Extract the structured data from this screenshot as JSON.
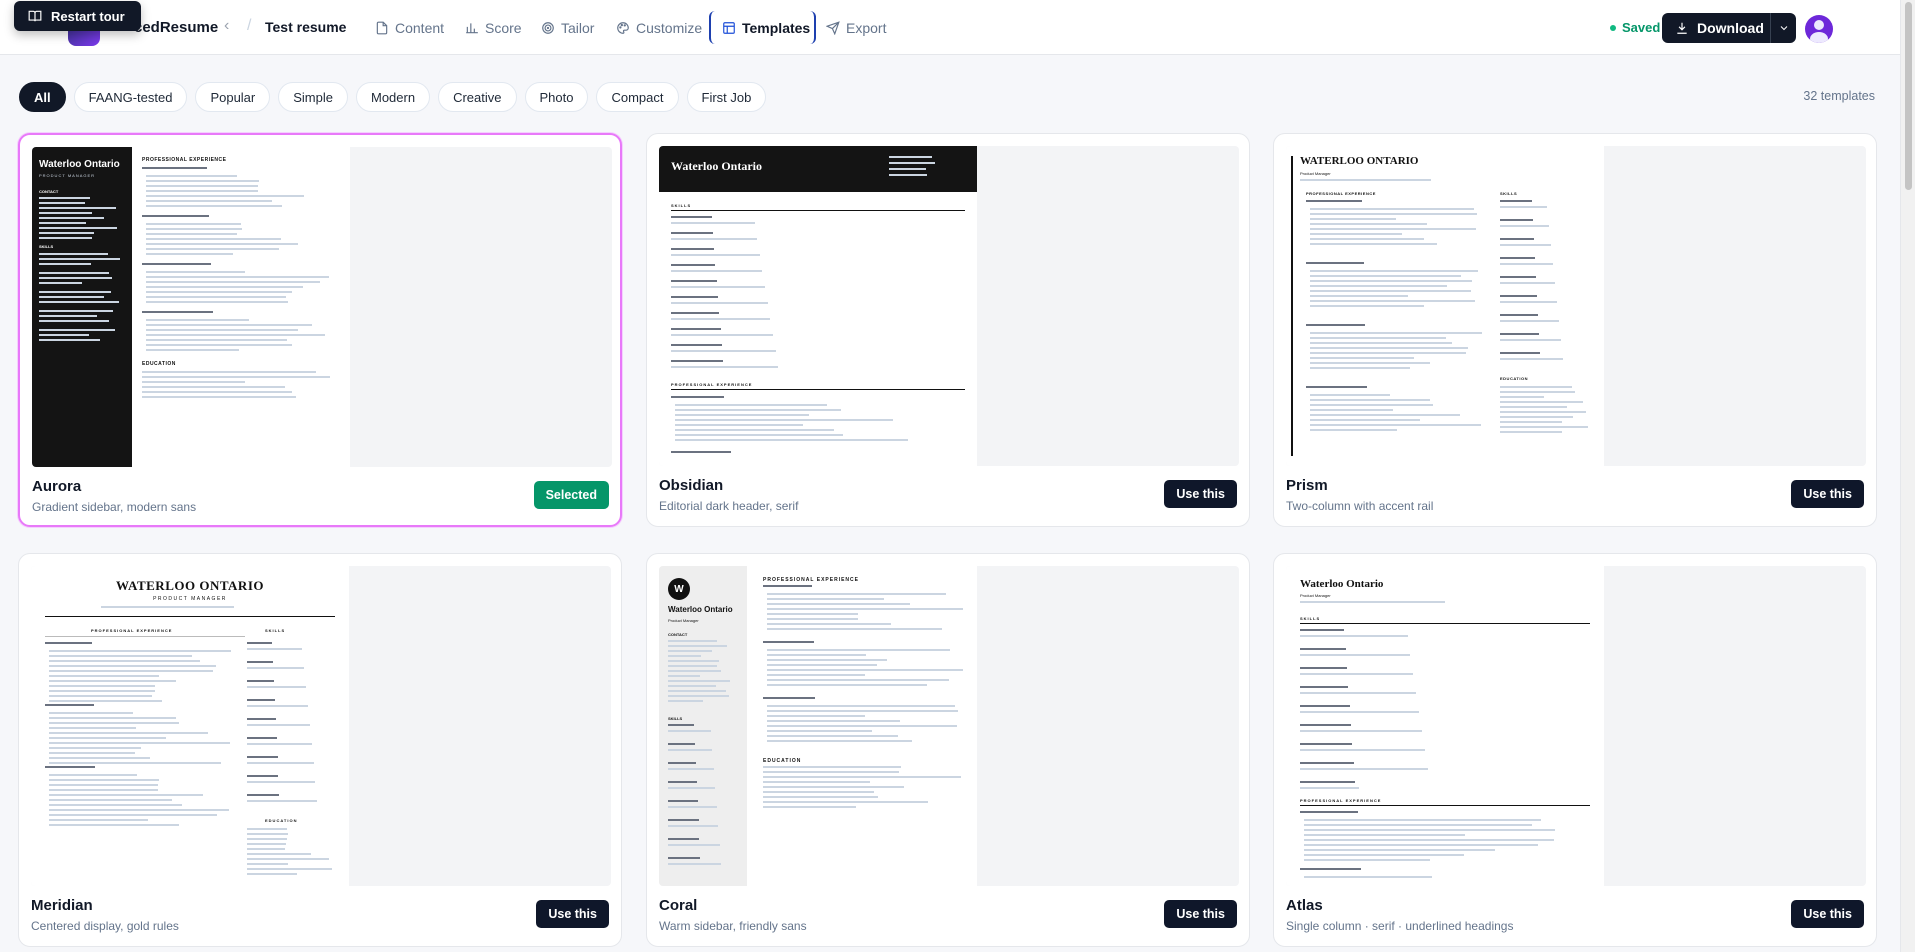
{
  "header": {
    "brand": "cedResume",
    "doc_title": "Test resume",
    "nav": [
      {
        "label": "Content",
        "icon": "file-icon"
      },
      {
        "label": "Score",
        "icon": "bar-chart-icon"
      },
      {
        "label": "Tailor",
        "icon": "target-icon"
      },
      {
        "label": "Customize",
        "icon": "palette-icon"
      },
      {
        "label": "Templates",
        "icon": "layout-grid-icon",
        "active": true
      },
      {
        "label": "Export",
        "icon": "send-icon"
      }
    ],
    "saved_label": "Saved",
    "download_label": "Download",
    "tour_label": "Restart tour"
  },
  "filters": {
    "chips": [
      "All",
      "FAANG-tested",
      "Popular",
      "Simple",
      "Modern",
      "Creative",
      "Photo",
      "Compact",
      "First Job"
    ],
    "active": "All",
    "count_label": "32 templates"
  },
  "templates": [
    {
      "name": "Aurora",
      "desc": "Gradient sidebar, modern sans",
      "button": "Selected",
      "selected": true
    },
    {
      "name": "Obsidian",
      "desc": "Editorial dark header, serif",
      "button": "Use this",
      "selected": false
    },
    {
      "name": "Prism",
      "desc": "Two-column with accent rail",
      "button": "Use this",
      "selected": false
    },
    {
      "name": "Meridian",
      "desc": "Centered display, gold rules",
      "button": "Use this",
      "selected": false
    },
    {
      "name": "Coral",
      "desc": "Warm sidebar, friendly sans",
      "button": "Use this",
      "selected": false
    },
    {
      "name": "Atlas",
      "desc": "Single column · serif · underlined headings",
      "button": "Use this",
      "selected": false
    }
  ],
  "previews": {
    "person_name": "Waterloo Ontario",
    "person_name_caps": "WATERLOO ONTARIO",
    "role": "Product Manager",
    "role_caps": "PRODUCT MANAGER",
    "sec_experience": "PROFESSIONAL EXPERIENCE",
    "sec_skills": "SKILLS",
    "sec_education": "EDUCATION",
    "sec_contact": "CONTACT",
    "avatar_initial": "W"
  },
  "colors": {
    "accent": "#111827",
    "selected_border": "#e879f9",
    "selected_button": "#059669",
    "saved": "#059669"
  }
}
